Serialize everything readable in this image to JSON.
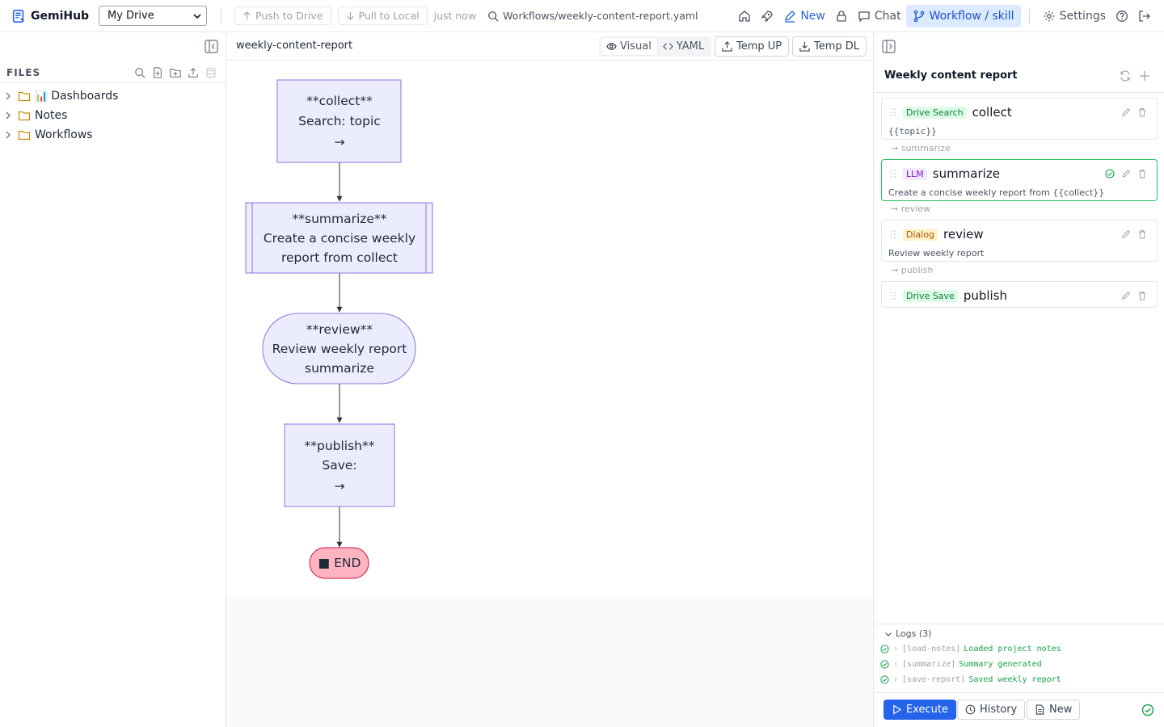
{
  "app": {
    "name": "GemiHub",
    "drive_select": "My Drive",
    "push_label": "Push to Drive",
    "pull_label": "Pull to Local",
    "sync_status": "just now",
    "file_path": "Workflows/weekly-content-report.yaml",
    "nav": {
      "new_label": "New",
      "chat_label": "Chat",
      "workflow_label": "Workflow / skill",
      "settings_label": "Settings"
    }
  },
  "sidebar": {
    "files_title": "FILES",
    "items": [
      {
        "emoji": "📊",
        "label": "Dashboards"
      },
      {
        "emoji": "",
        "label": "Notes"
      },
      {
        "emoji": "",
        "label": "Workflows"
      }
    ]
  },
  "editor": {
    "title": "weekly-content-report",
    "view_visual": "Visual",
    "view_yaml": "YAML",
    "temp_up": "Temp UP",
    "temp_dl": "Temp DL",
    "diagram": {
      "nodes": [
        {
          "lines": [
            "**collect**",
            "Search: topic",
            "→"
          ]
        },
        {
          "lines": [
            "**summarize**",
            "Create a concise weekly",
            "report from collect"
          ]
        },
        {
          "lines": [
            "**review**",
            "Review weekly report",
            "summarize"
          ]
        },
        {
          "lines": [
            "**publish**",
            "Save:",
            "→"
          ]
        },
        {
          "lines": [
            "■ END"
          ]
        }
      ]
    }
  },
  "workflow_panel": {
    "title": "Weekly content report",
    "nodes": [
      {
        "type": "Drive Search",
        "name": "collect",
        "desc": "{{topic}}",
        "next": "→ summarize"
      },
      {
        "type": "LLM",
        "name": "summarize",
        "desc": "Create a concise weekly report from {{collect}}",
        "next": "→ review"
      },
      {
        "type": "Dialog",
        "name": "review",
        "desc": "Review weekly report",
        "next": "→ publish"
      },
      {
        "type": "Drive Save",
        "name": "publish",
        "desc": "",
        "next": ""
      }
    ],
    "logs": {
      "title": "Logs (3)",
      "lines": [
        {
          "tag": "[load-notes]",
          "msg": "Loaded project notes"
        },
        {
          "tag": "[summarize]",
          "msg": "Summary generated"
        },
        {
          "tag": "[save-report]",
          "msg": "Saved weekly report"
        }
      ]
    },
    "execute_label": "Execute",
    "history_label": "History",
    "new_label": "New"
  },
  "colors": {
    "accent": "#2563eb",
    "node_fill": "#ececff",
    "node_stroke": "#9370db",
    "end_fill": "#ffb3c1",
    "end_stroke": "#c4183c",
    "success": "#16a34a"
  }
}
